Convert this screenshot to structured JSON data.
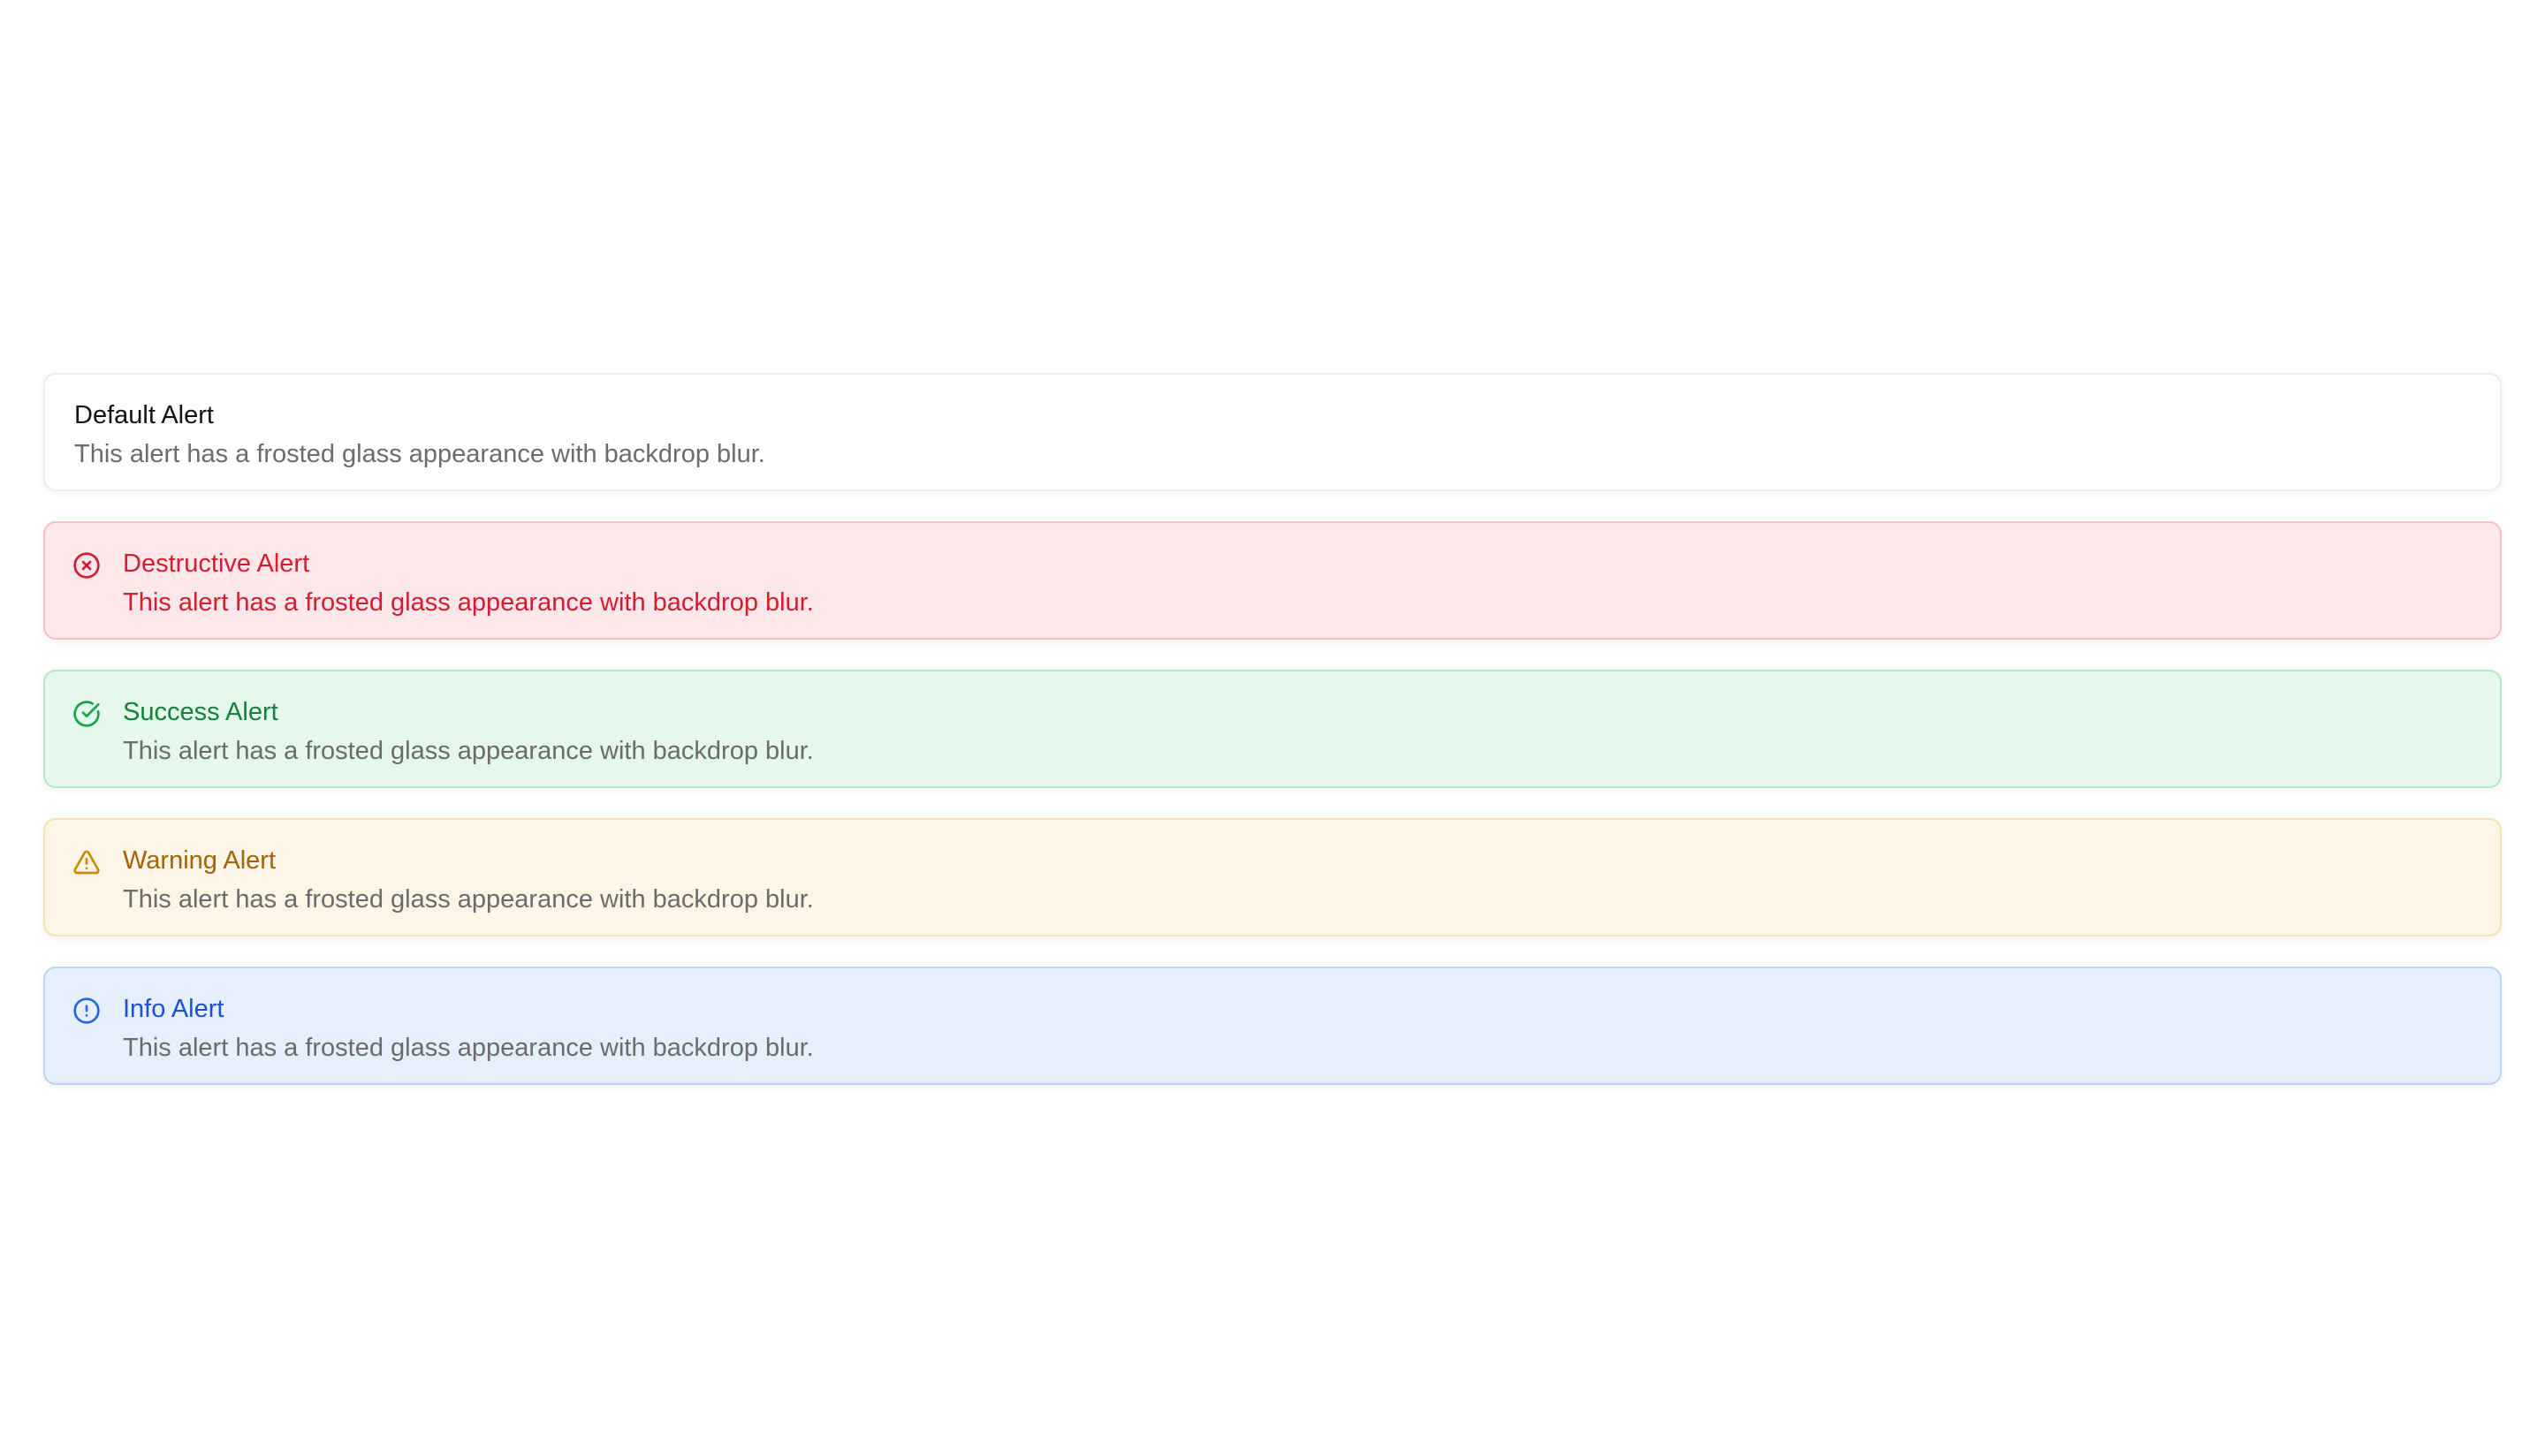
{
  "alerts": {
    "default": {
      "title": "Default Alert",
      "description": "This alert has a frosted glass appearance with backdrop blur."
    },
    "destructive": {
      "title": "Destructive Alert",
      "description": "This alert has a frosted glass appearance with backdrop blur.",
      "icon": "x-circle-icon",
      "color": "#d81b2f"
    },
    "success": {
      "title": "Success Alert",
      "description": "This alert has a frosted glass appearance with backdrop blur.",
      "icon": "check-circle-icon",
      "color": "#15803d"
    },
    "warning": {
      "title": "Warning Alert",
      "description": "This alert has a frosted glass appearance with backdrop blur.",
      "icon": "warning-triangle-icon",
      "color": "#a1620a"
    },
    "info": {
      "title": "Info Alert",
      "description": "This alert has a frosted glass appearance with backdrop blur.",
      "icon": "info-circle-icon",
      "color": "#1d4ed8"
    }
  }
}
